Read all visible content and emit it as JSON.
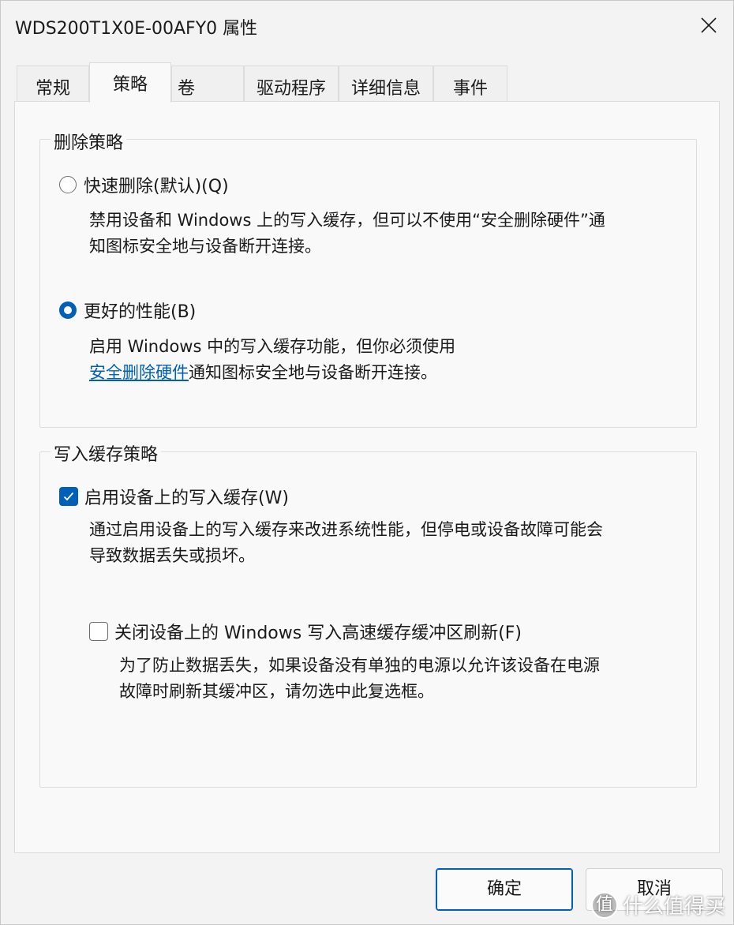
{
  "window": {
    "title": "WDS200T1X0E-00AFY0 属性",
    "close_icon": "close-icon"
  },
  "tabs": [
    {
      "label": "常规",
      "active": false
    },
    {
      "label": "策略",
      "active": true
    },
    {
      "label": "卷",
      "active": false
    },
    {
      "label": "驱动程序",
      "active": false
    },
    {
      "label": "详细信息",
      "active": false
    },
    {
      "label": "事件",
      "active": false
    }
  ],
  "removal_policy": {
    "title": "删除策略",
    "quick": {
      "label": "快速删除(默认)(Q)",
      "selected": false,
      "desc_line1": "禁用设备和 Windows 上的写入缓存，但可以不使用“安全删除硬件”通",
      "desc_line2": "知图标安全地与设备断开连接。"
    },
    "better": {
      "label": "更好的性能(B)",
      "selected": true,
      "desc_line1": "启用 Windows 中的写入缓存功能，但你必须使用",
      "desc_link": "安全删除硬件",
      "desc_line2_rest": "通知图标安全地与设备断开连接。"
    }
  },
  "write_cache_policy": {
    "title": "写入缓存策略",
    "enable": {
      "label": "启用设备上的写入缓存(W)",
      "checked": true,
      "desc_line1": "通过启用设备上的写入缓存来改进系统性能，但停电或设备故障可能会",
      "desc_line2": "导致数据丢失或损坏。"
    },
    "flush": {
      "label": "关闭设备上的 Windows 写入高速缓存缓冲区刷新(F)",
      "checked": false,
      "desc_line1": "为了防止数据丢失，如果设备没有单独的电源以允许该设备在电源",
      "desc_line2": "故障时刷新其缓冲区，请勿选中此复选框。"
    }
  },
  "buttons": {
    "ok": "确定",
    "cancel": "取消"
  },
  "watermark": {
    "logo_char": "值",
    "text": "什么值得买"
  },
  "colors": {
    "accent": "#005fb8",
    "link": "#005fb8"
  }
}
